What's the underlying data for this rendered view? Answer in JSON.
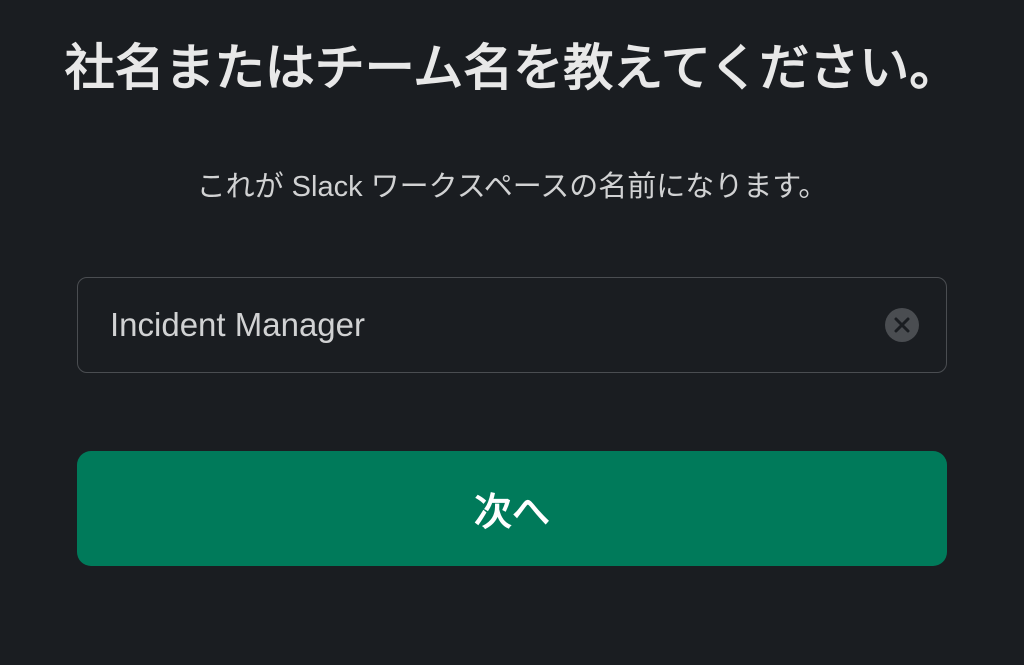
{
  "heading": "社名またはチーム名を教えてください。",
  "subtitle": "これが Slack ワークスペースの名前になります。",
  "input": {
    "value": "Incident Manager",
    "placeholder": ""
  },
  "buttons": {
    "next": "次へ"
  },
  "colors": {
    "background": "#1a1d21",
    "primary": "#007a5a",
    "text": "#e8e8e8",
    "subtext": "#d1d2d3",
    "border": "#4a4d51"
  }
}
